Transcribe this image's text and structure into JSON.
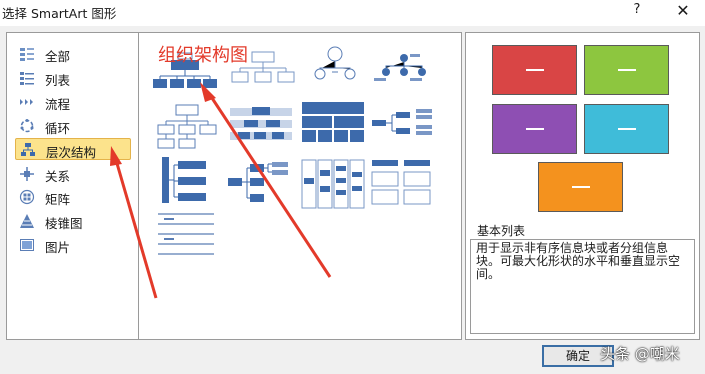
{
  "window": {
    "title": "选择 SmartArt 图形",
    "help_label": "?",
    "close_label": "✕"
  },
  "categories": [
    {
      "label": "全部",
      "icon": "all-icon"
    },
    {
      "label": "列表",
      "icon": "list-icon"
    },
    {
      "label": "流程",
      "icon": "process-icon"
    },
    {
      "label": "循环",
      "icon": "cycle-icon"
    },
    {
      "label": "层次结构",
      "icon": "hierarchy-icon",
      "selected": true
    },
    {
      "label": "关系",
      "icon": "relationship-icon"
    },
    {
      "label": "矩阵",
      "icon": "matrix-icon"
    },
    {
      "label": "棱锥图",
      "icon": "pyramid-icon"
    },
    {
      "label": "图片",
      "icon": "picture-icon"
    }
  ],
  "annotation": {
    "text": "组织架构图",
    "color": "#e33a2a"
  },
  "preview": {
    "colors": [
      "#d94545",
      "#8dc63f",
      "#8e4fb3",
      "#3fbcd9",
      "#f4921e"
    ],
    "box_label": "—"
  },
  "description": {
    "title": "基本列表",
    "text": "用于显示非有序信息块或者分组信息块。可最大化形状的水平和垂直显示空间。"
  },
  "buttons": {
    "ok": "确定"
  },
  "watermark": "头条 @嘲米",
  "colors": {
    "accent": "#2e5f9e",
    "selected_bg": "#fce38c",
    "annotation": "#e33a2a"
  }
}
